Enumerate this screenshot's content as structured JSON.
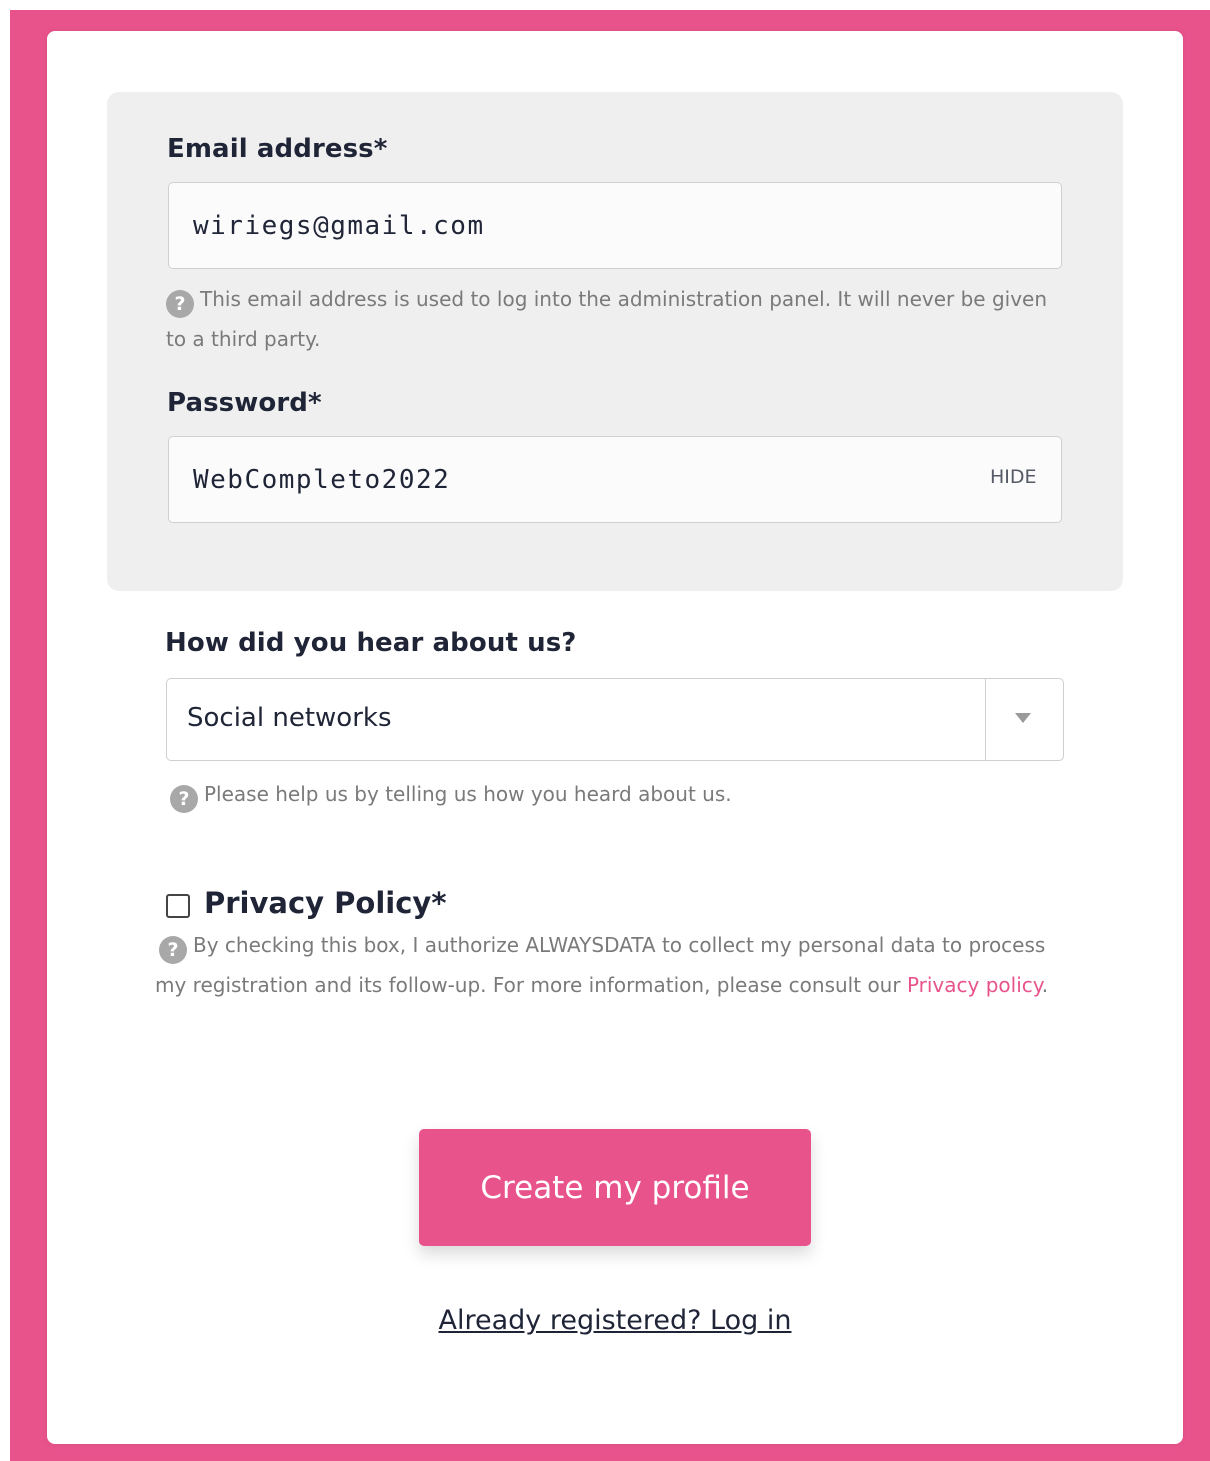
{
  "brand": {
    "accent_color": "#e9538c",
    "panel_color": "#efefef"
  },
  "email": {
    "label": "Email address*",
    "value": "wiriegs@gmail.com",
    "help_icon": "question-circle-icon",
    "hint": "This email address is used to log into the administration panel. It will never be given to a third party."
  },
  "password": {
    "label": "Password*",
    "value": "WebCompleto2022",
    "toggle_label": "HIDE"
  },
  "referral": {
    "label": "How did you hear about us?",
    "selected": "Social networks",
    "hint": "Please help us by telling us how you heard about us."
  },
  "privacy": {
    "label": "Privacy Policy*",
    "checked": false,
    "text_before_link": "By checking this box, I authorize ALWAYSDATA to collect my personal data to process my registration and its follow-up. For more information, please consult our ",
    "link_label": "Privacy policy",
    "text_after_link": "."
  },
  "actions": {
    "submit_label": "Create my profile",
    "login_label": "Already registered? Log in"
  }
}
